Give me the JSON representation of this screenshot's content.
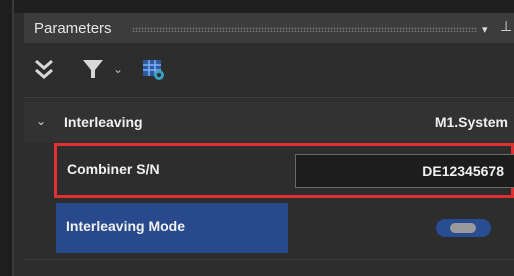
{
  "panel": {
    "title": "Parameters",
    "dropdown_glyph": "▾",
    "pin_glyph": "⊥"
  },
  "toolbar": {
    "collapse_icon": "chevron-double-down-icon",
    "filter_icon": "filter-icon",
    "filter_dropdown_glyph": "⌄",
    "settings_icon": "table-settings-icon"
  },
  "group": {
    "expand_glyph": "⌄",
    "name": "Interleaving",
    "value": "M1.System"
  },
  "properties": [
    {
      "label": "Combiner S/N",
      "value": "DE12345678"
    },
    {
      "label": "Interleaving Mode",
      "toggle_on": true
    }
  ],
  "colors": {
    "highlight_border": "#e03030",
    "selected_row": "#284a8c",
    "accent": "#294d93"
  }
}
